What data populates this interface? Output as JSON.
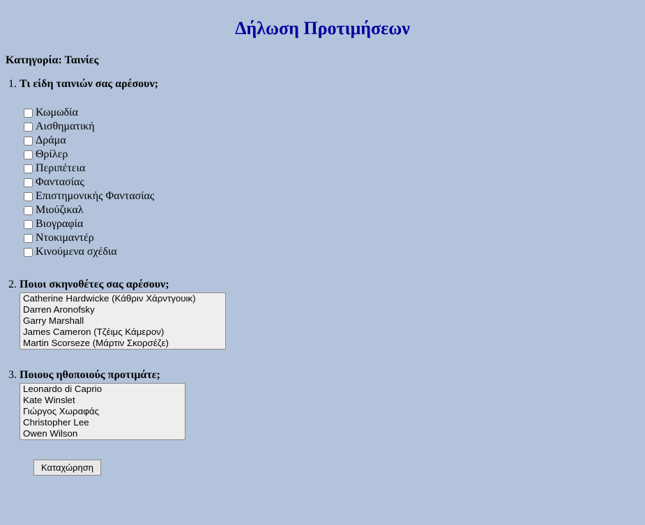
{
  "title": "Δήλωση Προτιμήσεων",
  "category_label": "Κατηγορία: Ταινίες",
  "questions": {
    "q1": {
      "text": "Τι είδη ταινιών σας αρέσουν;",
      "options": [
        "Κωμωδία",
        "Αισθηματική",
        "Δράμα",
        "Θρίλερ",
        "Περιπέτεια",
        "Φαντασίας",
        "Επιστημονικής Φαντασίας",
        "Μιούζικαλ",
        "Βιογραφία",
        "Ντοκιμαντέρ",
        "Κινούμενα σχέδια"
      ]
    },
    "q2": {
      "text": "Ποιοι σκηνοθέτες σας αρέσουν;",
      "options": [
        "Catherine Hardwicke (Κάθριν Χάρντγουικ)",
        "Darren Aronofsky",
        "Garry Marshall",
        "James Cameron (Τζέιμς Κάμερον)",
        "Martin Scorseze (Μάρτιν Σκορσέζε)"
      ]
    },
    "q3": {
      "text": "Ποιους ηθοποιούς προτιμάτε;",
      "options": [
        "Leonardo di Caprio",
        "Kate Winslet",
        "Γιώργος Χωραφάς",
        "Christopher Lee",
        "Owen Wilson"
      ]
    }
  },
  "submit_label": "Καταχώρηση"
}
